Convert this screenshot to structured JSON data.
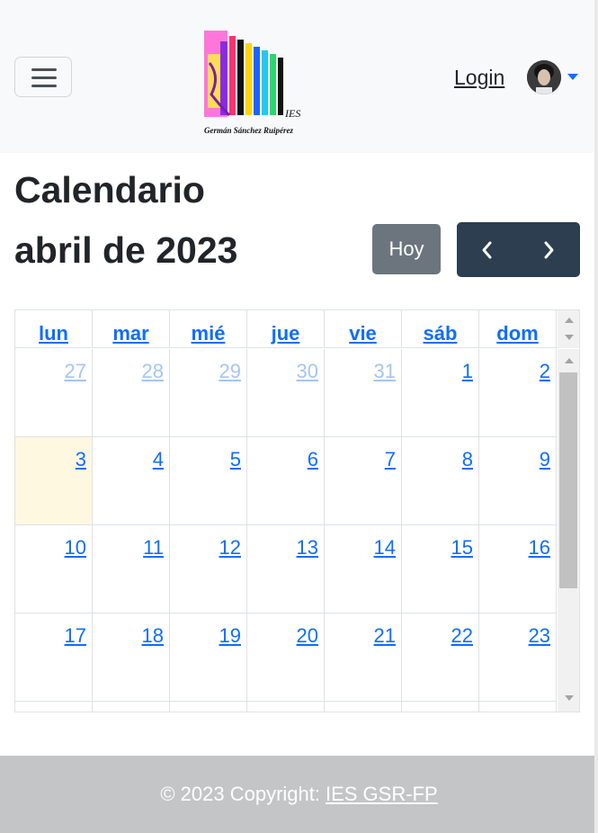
{
  "header": {
    "logo_text_ies": "IES",
    "logo_text_name": "Germán Sánchez Ruipérez",
    "login_label": "Login"
  },
  "main": {
    "page_title": "Calendario",
    "month_title": "abril de 2023",
    "today_button": "Hoy",
    "prev_icon": "chevron-left-icon",
    "next_icon": "chevron-right-icon"
  },
  "calendar": {
    "weekdays": [
      "lun",
      "mar",
      "mié",
      "jue",
      "vie",
      "sáb",
      "dom"
    ],
    "weeks": [
      [
        {
          "d": "27",
          "o": true
        },
        {
          "d": "28",
          "o": true
        },
        {
          "d": "29",
          "o": true
        },
        {
          "d": "30",
          "o": true
        },
        {
          "d": "31",
          "o": true
        },
        {
          "d": "1"
        },
        {
          "d": "2"
        }
      ],
      [
        {
          "d": "3",
          "t": true
        },
        {
          "d": "4"
        },
        {
          "d": "5"
        },
        {
          "d": "6"
        },
        {
          "d": "7"
        },
        {
          "d": "8"
        },
        {
          "d": "9"
        }
      ],
      [
        {
          "d": "10"
        },
        {
          "d": "11"
        },
        {
          "d": "12"
        },
        {
          "d": "13"
        },
        {
          "d": "14"
        },
        {
          "d": "15"
        },
        {
          "d": "16"
        }
      ],
      [
        {
          "d": "17"
        },
        {
          "d": "18"
        },
        {
          "d": "19"
        },
        {
          "d": "20"
        },
        {
          "d": "21"
        },
        {
          "d": "22"
        },
        {
          "d": "23"
        }
      ],
      [
        {
          "d": ""
        },
        {
          "d": ""
        },
        {
          "d": ""
        },
        {
          "d": ""
        },
        {
          "d": ""
        },
        {
          "d": ""
        },
        {
          "d": ""
        }
      ]
    ],
    "today_color": "#fff8e1",
    "link_color": "#0d6efd",
    "other_month_color": "#a4c5f4"
  },
  "footer": {
    "copyright": "© 2023 Copyright:",
    "link": "IES GSR-FP"
  },
  "colors": {
    "navbar_bg": "#f8f9fa",
    "nav_group_bg": "#2c3e50",
    "today_btn_bg": "#6c757d",
    "footer_bg": "#c4c5c6"
  }
}
